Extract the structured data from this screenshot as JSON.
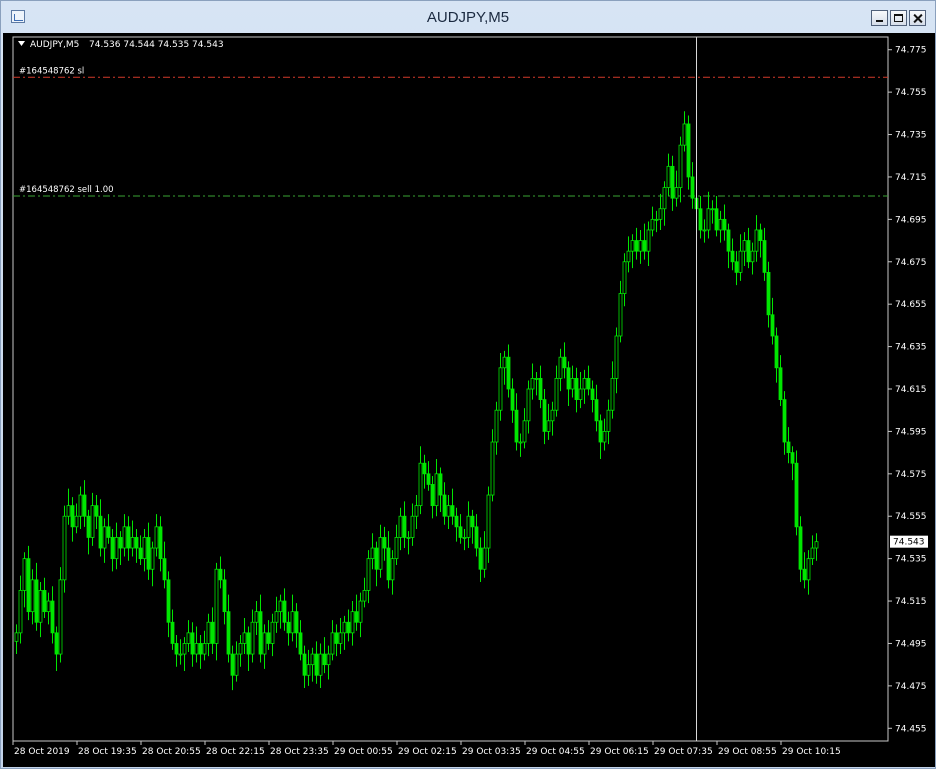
{
  "window": {
    "title": "AUDJPY,M5"
  },
  "chart_data": {
    "type": "candlestick",
    "symbol_header": "AUDJPY,M5",
    "ohlc_header": "74.536 74.544 74.535 74.543",
    "ylim": [
      74.449,
      74.781
    ],
    "y_ticks": [
      "74.775",
      "74.755",
      "74.735",
      "74.715",
      "74.695",
      "74.675",
      "74.655",
      "74.635",
      "74.615",
      "74.595",
      "74.575",
      "74.555",
      "74.535",
      "74.515",
      "74.495",
      "74.475",
      "74.455"
    ],
    "x_ticks": [
      "28 Oct 2019",
      "28 Oct 19:35",
      "28 Oct 20:55",
      "28 Oct 22:15",
      "28 Oct 23:35",
      "29 Oct 00:55",
      "29 Oct 02:15",
      "29 Oct 03:35",
      "29 Oct 04:55",
      "29 Oct 06:15",
      "29 Oct 07:35",
      "29 Oct 08:55",
      "29 Oct 10:15"
    ],
    "current_price": "74.543",
    "lines": [
      {
        "label": "#164548762 sl",
        "price": 74.762,
        "color": "#d23a2a"
      },
      {
        "label": "#164548762 sell 1.00",
        "price": 74.706,
        "color": "#3aa335"
      }
    ],
    "crosshair_x_index": 170,
    "candle_color": "#00e600",
    "closes": [
      74.5,
      74.52,
      74.535,
      74.51,
      74.525,
      74.505,
      74.52,
      74.51,
      74.515,
      74.5,
      74.49,
      74.525,
      74.555,
      74.56,
      74.55,
      74.555,
      74.565,
      74.555,
      74.545,
      74.56,
      74.555,
      74.54,
      74.55,
      74.545,
      74.535,
      74.545,
      74.54,
      74.55,
      74.54,
      74.545,
      74.54,
      74.535,
      74.545,
      74.53,
      74.54,
      74.55,
      74.535,
      74.525,
      74.505,
      74.495,
      74.49,
      74.49,
      74.495,
      74.5,
      74.49,
      74.495,
      74.49,
      74.495,
      74.505,
      74.495,
      74.53,
      74.525,
      74.51,
      74.49,
      74.48,
      74.49,
      74.495,
      74.5,
      74.49,
      74.505,
      74.51,
      74.49,
      74.5,
      74.495,
      74.505,
      74.51,
      74.515,
      74.505,
      74.5,
      74.51,
      74.5,
      74.49,
      74.48,
      74.485,
      74.49,
      74.48,
      74.49,
      74.485,
      74.49,
      74.5,
      74.495,
      74.5,
      74.505,
      74.5,
      74.51,
      74.505,
      74.515,
      74.52,
      74.535,
      74.54,
      74.53,
      74.545,
      74.54,
      74.525,
      74.535,
      74.545,
      74.555,
      74.545,
      74.545,
      74.555,
      74.56,
      74.58,
      74.575,
      74.57,
      74.56,
      74.575,
      74.565,
      74.555,
      74.56,
      74.555,
      74.55,
      74.545,
      74.545,
      74.555,
      74.55,
      74.54,
      74.53,
      74.54,
      74.565,
      74.59,
      74.605,
      74.625,
      74.63,
      74.615,
      74.605,
      74.59,
      74.59,
      74.6,
      74.615,
      74.62,
      74.62,
      74.61,
      74.595,
      74.6,
      74.605,
      74.62,
      74.63,
      74.625,
      74.615,
      74.62,
      74.61,
      74.615,
      74.62,
      74.615,
      74.61,
      74.6,
      74.59,
      74.595,
      74.605,
      74.62,
      74.64,
      74.66,
      74.675,
      74.68,
      74.685,
      74.68,
      74.685,
      74.68,
      74.69,
      74.695,
      74.695,
      74.7,
      74.71,
      74.72,
      74.705,
      74.71,
      74.73,
      74.74,
      74.715,
      74.705,
      74.7,
      74.69,
      74.69,
      74.7,
      74.7,
      74.69,
      74.695,
      74.69,
      74.68,
      74.675,
      74.67,
      74.68,
      74.685,
      74.675,
      74.68,
      74.69,
      74.685,
      74.67,
      74.65,
      74.64,
      74.625,
      74.61,
      74.59,
      74.585,
      74.58,
      74.55,
      74.53,
      74.525,
      74.535,
      74.54,
      74.543
    ]
  }
}
